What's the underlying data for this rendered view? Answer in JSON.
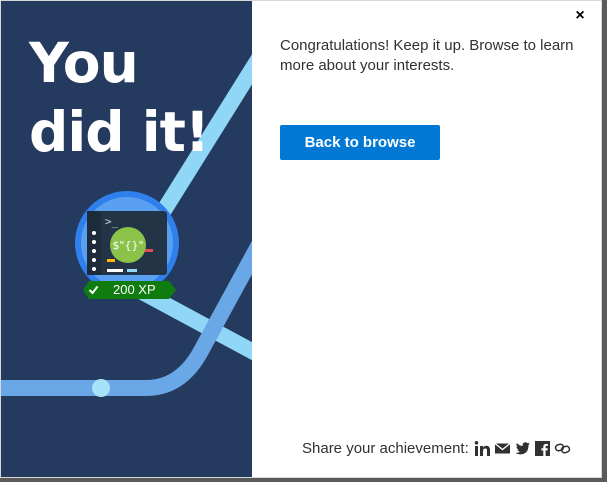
{
  "dialog": {
    "headline_line1": "You",
    "headline_line2": "did it!",
    "close_glyph": "×",
    "message": "Congratulations! Keep it up. Browse to learn more about your interests.",
    "back_button_label": "Back to browse",
    "xp_label": "200 XP",
    "share_label": "Share your achievement:",
    "share_icons": [
      "linkedin-icon",
      "email-icon",
      "twitter-icon",
      "facebook-icon",
      "link-icon"
    ]
  },
  "colors": {
    "panel_bg": "#243a5e",
    "accent": "#0078d4",
    "badge_ring": "#2f80ed",
    "xp_ribbon": "#107c10",
    "line_light": "#8fd6f7",
    "line_mid": "#6aa7e6"
  }
}
